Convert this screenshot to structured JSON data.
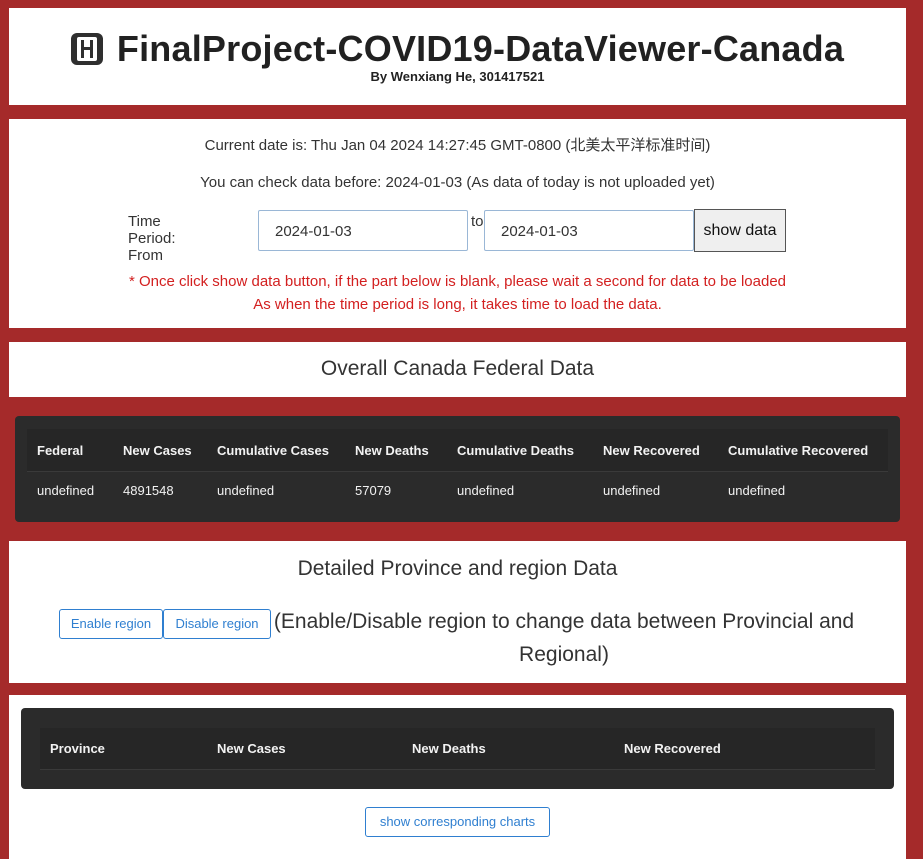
{
  "header": {
    "title": "FinalProject-COVID19-DataViewer-Canada",
    "byline": "By Wenxiang He, 301417521",
    "icon": "h-square-icon"
  },
  "date_panel": {
    "current_date": "Current date is: Thu Jan 04 2024 14:27:45 GMT-0800 (北美太平洋标准时间)",
    "check_before": "You can check data before: 2024-01-03 (As data of today is not uploaded yet)",
    "from_label": "Time Period: From",
    "to_label": "to",
    "from_value": "2024-01-03",
    "to_value": "2024-01-03",
    "show_button": "show data",
    "warning_1": "* Once click show data button, if the part below is blank, please wait a second for data to be loaded",
    "warning_2": "As when the time period is long, it takes time to load the data."
  },
  "overall": {
    "title": "Overall Canada Federal Data",
    "headers": [
      "Federal",
      "New Cases",
      "Cumulative Cases",
      "New Deaths",
      "Cumulative Deaths",
      "New Recovered",
      "Cumulative Recovered"
    ],
    "row": [
      "undefined",
      "4891548",
      "undefined",
      "57079",
      "undefined",
      "undefined",
      "undefined"
    ]
  },
  "detail": {
    "title": "Detailed Province and region Data",
    "enable_button": "Enable region",
    "disable_button": "Disable region",
    "note": "(Enable/Disable region to change data between Provincial and Regional)"
  },
  "province_table": {
    "headers": [
      "Province",
      "New Cases",
      "New Deaths",
      "New Recovered"
    ]
  },
  "charts_button": "show corresponding charts",
  "colors": {
    "background": "#a52a2a",
    "panel": "#ffffff",
    "table_dark": "#2b2b2b",
    "warning": "#d32020",
    "accent": "#2f7fd0"
  }
}
